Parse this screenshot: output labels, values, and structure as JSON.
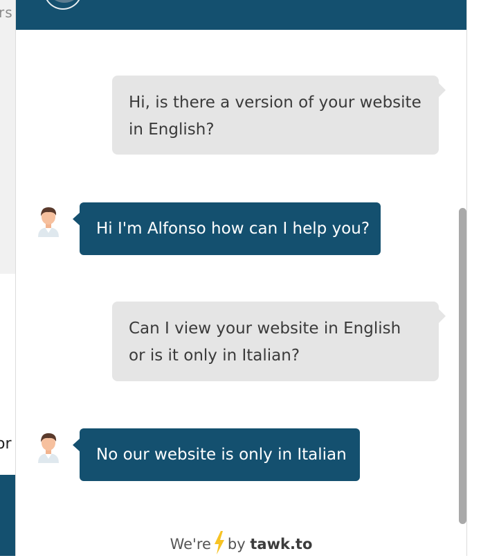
{
  "background_page": {
    "top_text": "rs",
    "mid_text": "or"
  },
  "conversation": [
    {
      "role": "visitor",
      "text": "Hi, is there a version of your website in English?"
    },
    {
      "role": "agent",
      "text": "Hi I'm Alfonso how can I help you?"
    },
    {
      "role": "visitor",
      "text": "Can I view your website in English or is it only in Italian?"
    },
    {
      "role": "agent",
      "text": "No our website is only in Italian"
    }
  ],
  "footer": {
    "prefix": "We're",
    "icon": "lightning-bolt-icon",
    "by": "by",
    "brand": "tawk.to"
  },
  "colors": {
    "header": "#14506f",
    "agent_bubble": "#14506f",
    "visitor_bubble": "#e5e5e5",
    "bolt": "#f7c325"
  }
}
